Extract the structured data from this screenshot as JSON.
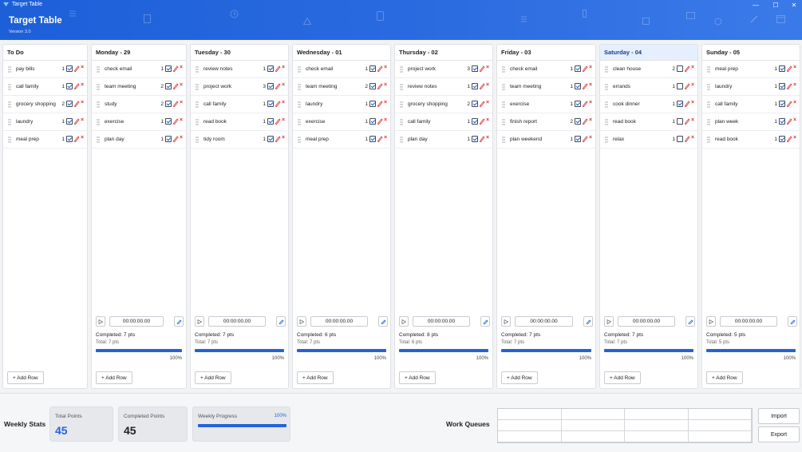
{
  "window": {
    "title": "Target Table",
    "controls": [
      "—",
      "☐",
      "✕"
    ]
  },
  "header": {
    "app_title": "Target Table",
    "version": "Version 3.0"
  },
  "colors": {
    "accent": "#2462d9",
    "header": "#1c5fd8",
    "delete": "#d33333",
    "edit": "#d43a3a"
  },
  "columns": [
    {
      "title": "To Do",
      "today": false,
      "has_footer": false,
      "add_row": "+ Add Row",
      "tasks": [
        {
          "name": "pay bills",
          "pts": "1",
          "done": true
        },
        {
          "name": "call family",
          "pts": "1",
          "done": true
        },
        {
          "name": "grocery shopping",
          "pts": "2",
          "done": true
        },
        {
          "name": "laundry",
          "pts": "1",
          "done": true
        },
        {
          "name": "meal prep",
          "pts": "1",
          "done": true
        }
      ]
    },
    {
      "title": "Monday - 29",
      "today": false,
      "has_footer": true,
      "timer": "00:00:00.00",
      "completed": "Completed: 7 pts",
      "total": "Total: 7 pts",
      "progress": 1.0,
      "pct": "100%",
      "add_row": "+ Add Row",
      "tasks": [
        {
          "name": "check email",
          "pts": "1",
          "done": true
        },
        {
          "name": "team meeting",
          "pts": "2",
          "done": true
        },
        {
          "name": "study",
          "pts": "2",
          "done": true
        },
        {
          "name": "exercise",
          "pts": "1",
          "done": true
        },
        {
          "name": "plan day",
          "pts": "1",
          "done": true
        }
      ]
    },
    {
      "title": "Tuesday - 30",
      "today": false,
      "has_footer": true,
      "timer": "00:00:00.00",
      "completed": "Completed: 7 pts",
      "total": "Total: 7 pts",
      "progress": 1.0,
      "pct": "100%",
      "add_row": "+ Add Row",
      "tasks": [
        {
          "name": "review notes",
          "pts": "1",
          "done": true
        },
        {
          "name": "project work",
          "pts": "3",
          "done": true
        },
        {
          "name": "call family",
          "pts": "1",
          "done": true
        },
        {
          "name": "read book",
          "pts": "1",
          "done": true
        },
        {
          "name": "tidy room",
          "pts": "1",
          "done": true
        }
      ]
    },
    {
      "title": "Wednesday - 01",
      "today": false,
      "has_footer": true,
      "timer": "00:00:00.00",
      "completed": "Completed: 6 pts",
      "total": "Total: 7 pts",
      "progress": 1.0,
      "pct": "100%",
      "add_row": "+ Add Row",
      "tasks": [
        {
          "name": "check email",
          "pts": "1",
          "done": true
        },
        {
          "name": "team meeting",
          "pts": "2",
          "done": true
        },
        {
          "name": "laundry",
          "pts": "1",
          "done": true
        },
        {
          "name": "exercise",
          "pts": "1",
          "done": true
        },
        {
          "name": "meal prep",
          "pts": "1",
          "done": true
        }
      ]
    },
    {
      "title": "Thursday - 02",
      "today": false,
      "has_footer": true,
      "timer": "00:00:00.00",
      "completed": "Completed: 8 pts",
      "total": "Total: 6 pts",
      "progress": 1.0,
      "pct": "100%",
      "add_row": "+ Add Row",
      "tasks": [
        {
          "name": "project work",
          "pts": "3",
          "done": true
        },
        {
          "name": "review notes",
          "pts": "1",
          "done": true
        },
        {
          "name": "grocery shopping",
          "pts": "2",
          "done": true
        },
        {
          "name": "call family",
          "pts": "1",
          "done": true
        },
        {
          "name": "plan day",
          "pts": "1",
          "done": true
        }
      ]
    },
    {
      "title": "Friday - 03",
      "today": false,
      "has_footer": true,
      "timer": "00:00:00.00",
      "completed": "Completed: 7 pts",
      "total": "Total: 7 pts",
      "progress": 1.0,
      "pct": "100%",
      "add_row": "+ Add Row",
      "tasks": [
        {
          "name": "check email",
          "pts": "1",
          "done": true
        },
        {
          "name": "team meeting",
          "pts": "1",
          "done": true
        },
        {
          "name": "exercise",
          "pts": "1",
          "done": true
        },
        {
          "name": "finish report",
          "pts": "2",
          "done": true
        },
        {
          "name": "plan weekend",
          "pts": "1",
          "done": true
        }
      ]
    },
    {
      "title": "Saturday - 04",
      "today": true,
      "has_footer": true,
      "timer": "00:00:00.00",
      "completed": "Completed: 7 pts",
      "total": "Total: 7 pts",
      "progress": 1.0,
      "pct": "100%",
      "add_row": "+ Add Row",
      "tasks": [
        {
          "name": "clean house",
          "pts": "2",
          "done": false
        },
        {
          "name": "errands",
          "pts": "1",
          "done": false
        },
        {
          "name": "cook dinner",
          "pts": "1",
          "done": true
        },
        {
          "name": "read book",
          "pts": "1",
          "done": false
        },
        {
          "name": "relax",
          "pts": "1",
          "done": false
        }
      ]
    },
    {
      "title": "Sunday - 05",
      "today": false,
      "has_footer": true,
      "timer": "00:00:00.00",
      "completed": "Completed: 5 pts",
      "total": "Total: 5 pts",
      "progress": 1.0,
      "pct": "100%",
      "add_row": "+ Add Row",
      "tasks": [
        {
          "name": "meal prep",
          "pts": "1",
          "done": true
        },
        {
          "name": "laundry",
          "pts": "1",
          "done": true
        },
        {
          "name": "call family",
          "pts": "1",
          "done": true
        },
        {
          "name": "plan week",
          "pts": "1",
          "done": true
        },
        {
          "name": "read book",
          "pts": "1",
          "done": true
        }
      ]
    }
  ],
  "footer": {
    "weekly_stats_label": "Weekly Stats",
    "total_points_label": "Total Points",
    "total_points_value": "45",
    "completed_points_label": "Completed Points",
    "completed_points_value": "45",
    "weekly_progress_label": "Weekly Progress",
    "weekly_progress_pct": "100%",
    "weekly_progress": 1.0,
    "work_queues_label": "Work Queues",
    "import_label": "Import",
    "export_label": "Export"
  }
}
